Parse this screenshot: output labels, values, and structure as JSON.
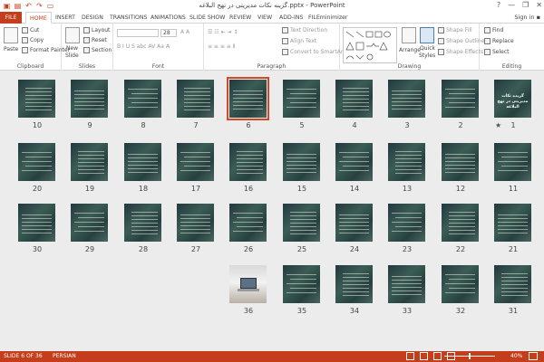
{
  "window": {
    "title": "گزینه نکات مدیریتی در نهج البلاغه.pptx - PowerPoint",
    "controls": [
      "?",
      "—",
      "❐",
      "✕"
    ],
    "sign_in": "Sign in"
  },
  "tabs": [
    {
      "label": "FILE"
    },
    {
      "label": "HOME",
      "active": true
    },
    {
      "label": "INSERT"
    },
    {
      "label": "DESIGN"
    },
    {
      "label": "TRANSITIONS"
    },
    {
      "label": "ANIMATIONS"
    },
    {
      "label": "SLIDE SHOW"
    },
    {
      "label": "REVIEW"
    },
    {
      "label": "VIEW"
    },
    {
      "label": "ADD-INS"
    },
    {
      "label": "FILEminimizer"
    }
  ],
  "ribbon": {
    "clipboard": {
      "label": "Clipboard",
      "paste": "Paste",
      "cut": "Cut",
      "copy": "Copy",
      "format_painter": "Format Painter"
    },
    "slides": {
      "label": "Slides",
      "new_slide": "New",
      "new_slide2": "Slide",
      "layout": "Layout",
      "reset": "Reset",
      "section": "Section"
    },
    "font": {
      "label": "Font",
      "size": "28"
    },
    "paragraph": {
      "label": "Paragraph",
      "text_direction": "Text Direction",
      "align_text": "Align Text",
      "convert": "Convert to SmartArt"
    },
    "drawing": {
      "label": "Drawing",
      "arrange": "Arrange",
      "quick_styles": "Quick",
      "quick_styles2": "Styles",
      "shape_fill": "Shape Fill",
      "shape_outline": "Shape Outline",
      "shape_effects": "Shape Effects"
    },
    "editing": {
      "label": "Editing",
      "find": "Find",
      "replace": "Replace",
      "select": "Select"
    }
  },
  "slides": {
    "selected": 6,
    "cover_title": "گزیده نکات مدیریتی در نهج البلاغه",
    "numbers": [
      "1",
      "2",
      "3",
      "4",
      "5",
      "6",
      "7",
      "8",
      "9",
      "10",
      "11",
      "12",
      "13",
      "14",
      "15",
      "16",
      "17",
      "18",
      "19",
      "20",
      "21",
      "22",
      "23",
      "24",
      "25",
      "26",
      "27",
      "28",
      "29",
      "30",
      "31",
      "32",
      "33",
      "34",
      "35",
      "36"
    ]
  },
  "status": {
    "slide_info": "SLIDE 6 OF 36",
    "language": "PERSIAN",
    "zoom": "40%",
    "zoom_level": 40
  }
}
